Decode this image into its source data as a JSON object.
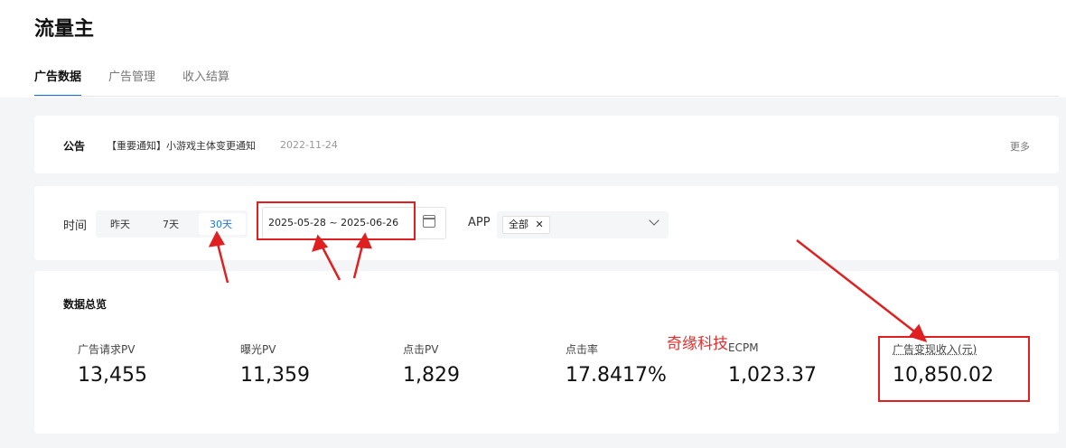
{
  "app": {
    "title": "流量主"
  },
  "tabs": [
    {
      "label": "广告数据",
      "active": true
    },
    {
      "label": "广告管理",
      "active": false
    },
    {
      "label": "收入结算",
      "active": false
    }
  ],
  "notice": {
    "label": "公告",
    "text": "【重要通知】小游戏主体变更通知",
    "date": "2022-11-24",
    "more": "更多"
  },
  "filter": {
    "time_label": "时间",
    "range_options": [
      {
        "label": "昨天",
        "active": false
      },
      {
        "label": "7天",
        "active": false
      },
      {
        "label": "30天",
        "active": true
      }
    ],
    "date_range": "2025-05-28 ~ 2025-06-26",
    "app_label": "APP",
    "app_selected": "全部",
    "remove_glyph": "✕"
  },
  "overview": {
    "title": "数据总览",
    "brand_text": "奇缘科技",
    "metrics": [
      {
        "label": "广告请求PV",
        "value": "13,455"
      },
      {
        "label": "曝光PV",
        "value": "11,359"
      },
      {
        "label": "点击PV",
        "value": "1,829"
      },
      {
        "label": "点击率",
        "value": "17.8417%"
      },
      {
        "label": "ECPM",
        "value": "1,023.37"
      },
      {
        "label": "广告变现收入(元)",
        "value": "10,850.02"
      }
    ]
  },
  "colors": {
    "accent": "#1a73e8",
    "annotation": "#e02020"
  }
}
